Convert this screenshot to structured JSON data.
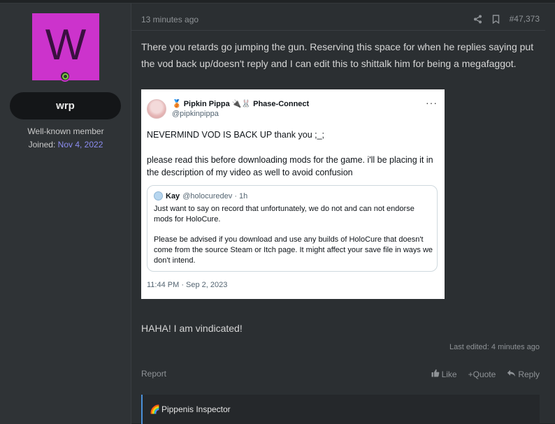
{
  "user": {
    "avatar_letter": "W",
    "avatar_color": "#cc33cc",
    "username": "wrp",
    "title": "Well-known member",
    "joined_label": "Joined:",
    "joined_date": "Nov 4, 2022"
  },
  "post": {
    "time": "13 minutes ago",
    "post_number": "#47,373",
    "body": "There you retards go jumping the gun. Reserving this space for when he replies saying put the vod back up/doesn't reply and I can edit this to shittalk him for being a megafaggot.",
    "body2": "HAHA! I am vindicated!",
    "last_edited": "Last edited: 4 minutes ago",
    "report_label": "Report",
    "like_label": "Like",
    "quote_label": "+Quote",
    "reply_label": "Reply",
    "signature": "Pippenis Inspector"
  },
  "tweet": {
    "display_name": "Pipkin Pippa",
    "name_suffix": "Phase-Connect",
    "handle": "@pipkinpippa",
    "more": "···",
    "text1": "NEVERMIND VOD IS BACK UP thank you ;_;",
    "text2": "please read this before downloading mods for the game. i'll be placing it in the description of my video as well to avoid confusion",
    "quote": {
      "name": "Kay",
      "handle": "@holocuredev · 1h",
      "text1": "Just want to say on record that unfortunately, we do not and can not endorse mods for HoloCure.",
      "text2": "Please be advised if you download and use any builds of HoloCure that doesn't come from the source Steam or Itch page. It might affect your save file in ways we don't intend."
    },
    "timestamp": "11:44 PM · Sep 2, 2023"
  }
}
